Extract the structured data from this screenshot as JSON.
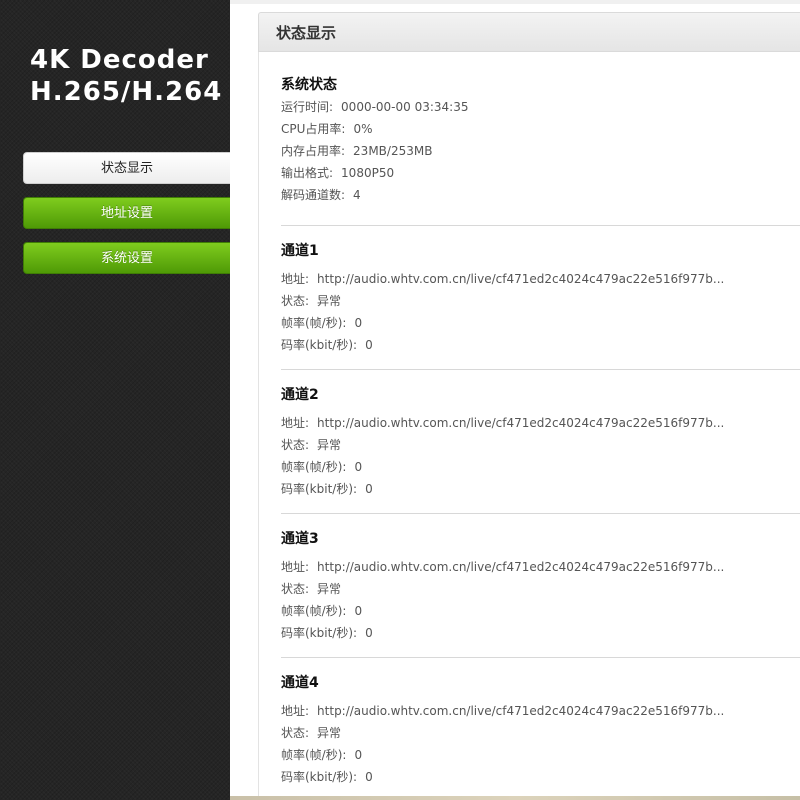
{
  "logo": {
    "line1": "4K Decoder",
    "line2": "H.265/H.264"
  },
  "nav": [
    {
      "label": "状态显示",
      "active": true
    },
    {
      "label": "地址设置",
      "active": false
    },
    {
      "label": "系统设置",
      "active": false
    }
  ],
  "panel_title": "状态显示",
  "system": {
    "title": "系统状态",
    "uptime_label": "运行时间:",
    "uptime": "0000-00-00 03:34:35",
    "cpu_label": "CPU占用率:",
    "cpu": "0%",
    "mem_label": "内存占用率:",
    "mem": "23MB/253MB",
    "format_label": "输出格式:",
    "format": "1080P50",
    "channels_label": "解码通道数:",
    "channels": "4"
  },
  "channels": [
    {
      "title": "通道1",
      "addr_label": "地址:",
      "addr": "http://audio.whtv.com.cn/live/cf471ed2c4024c479ac22e516f977b...",
      "status_label": "状态:",
      "status": "异常",
      "fps_label": "帧率(帧/秒):",
      "fps": "0",
      "bitrate_label": "码率(kbit/秒):",
      "bitrate": "0"
    },
    {
      "title": "通道2",
      "addr_label": "地址:",
      "addr": "http://audio.whtv.com.cn/live/cf471ed2c4024c479ac22e516f977b...",
      "status_label": "状态:",
      "status": "异常",
      "fps_label": "帧率(帧/秒):",
      "fps": "0",
      "bitrate_label": "码率(kbit/秒):",
      "bitrate": "0"
    },
    {
      "title": "通道3",
      "addr_label": "地址:",
      "addr": "http://audio.whtv.com.cn/live/cf471ed2c4024c479ac22e516f977b...",
      "status_label": "状态:",
      "status": "异常",
      "fps_label": "帧率(帧/秒):",
      "fps": "0",
      "bitrate_label": "码率(kbit/秒):",
      "bitrate": "0"
    },
    {
      "title": "通道4",
      "addr_label": "地址:",
      "addr": "http://audio.whtv.com.cn/live/cf471ed2c4024c479ac22e516f977b...",
      "status_label": "状态:",
      "status": "异常",
      "fps_label": "帧率(帧/秒):",
      "fps": "0",
      "bitrate_label": "码率(kbit/秒):",
      "bitrate": "0"
    }
  ]
}
